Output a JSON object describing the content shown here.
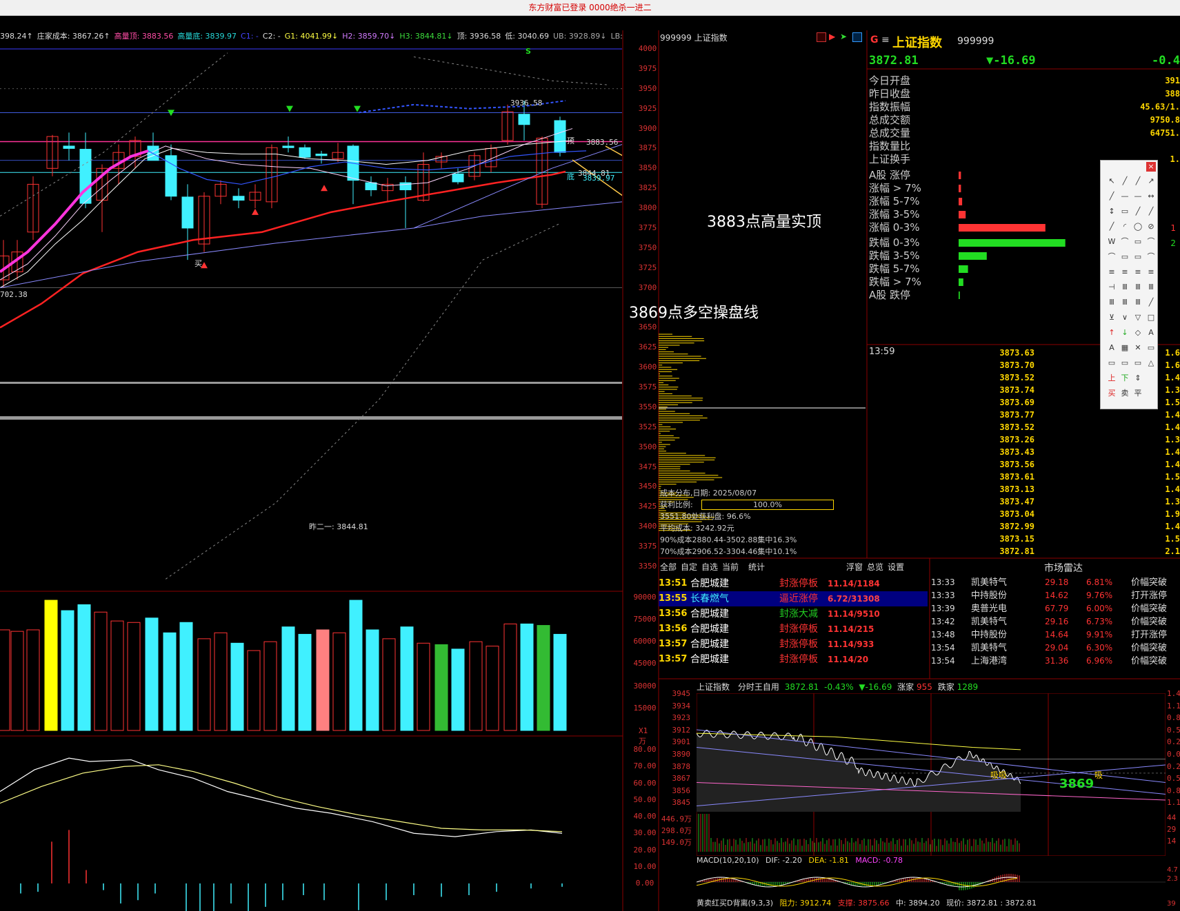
{
  "titlebar": {
    "text": "东方财富已登录  0000绝杀一进二"
  },
  "kline_info": [
    {
      "text": "398.24↑",
      "color": "#dddddd"
    },
    {
      "text": "庄家成本: 3867.26↑",
      "color": "#dddddd"
    },
    {
      "text": "高量顶: 3883.56",
      "color": "#ff4da6"
    },
    {
      "text": "高量底: 3839.97",
      "color": "#26d9d9"
    },
    {
      "text": "C1: -",
      "color": "#4444ff"
    },
    {
      "text": "C2: -",
      "color": "#dddddd"
    },
    {
      "text": "G1: 4041.99↓",
      "color": "#ffff44"
    },
    {
      "text": "H2: 3859.70↓",
      "color": "#d27bff"
    },
    {
      "text": "H3: 3844.81↓",
      "color": "#3cdc3c"
    },
    {
      "text": "顶: 3936.58",
      "color": "#dddddd"
    },
    {
      "text": "低: 3040.69",
      "color": "#dddddd"
    },
    {
      "text": "UB: 3928.89↓",
      "color": "#aaaaaa"
    },
    {
      "text": "LB: 3",
      "color": "#aaaaaa"
    }
  ],
  "price_axis": [
    "4000",
    "3975",
    "3950",
    "3925",
    "3900",
    "3875",
    "3850",
    "3825",
    "3800",
    "3775",
    "3750",
    "3725",
    "3700",
    "3650",
    "3625",
    "3600",
    "3575",
    "3550",
    "3525",
    "3500",
    "3475",
    "3450",
    "3425",
    "3400",
    "3375",
    "3350"
  ],
  "vol_axis": [
    "90000",
    "75000",
    "60000",
    "45000",
    "30000",
    "15000",
    "X1万"
  ],
  "ind_axis": [
    "80.00",
    "70.00",
    "60.00",
    "50.00",
    "40.00",
    "30.00",
    "20.00",
    "10.00",
    "0.00"
  ],
  "chart_labels": {
    "top_mark": "3936.58",
    "ding": "顶",
    "ding_val": "3883.56",
    "di": "底",
    "di_val": "3844.81",
    "di_val2": "3839.97",
    "left_low": "702.38",
    "buy": "买",
    "s_mark": "S",
    "yesterday": "昨二一: 3844.81"
  },
  "annotations": {
    "a1": "3883点高量实顶",
    "a2": "3869点多空操盘线"
  },
  "chip": {
    "header": "999999 上证指数",
    "date": "成本分布,日期: 2025/08/07",
    "profit_label": "获利比例:",
    "profit_pct": "100.0%",
    "l3": "3551.80处获利盘: 96.6%",
    "l4": "平均成本: 3242.92元",
    "l5": "90%成本2880.44-3502.88集中16.3%",
    "l6": "70%成本2906.52-3304.46集中10.1%"
  },
  "quote": {
    "g": "G",
    "menu": "≡",
    "name": "上证指数",
    "code": "999999",
    "price": "3872.81",
    "change": "▼-16.69",
    "pct": "-0.4",
    "rows": [
      {
        "label": "今日开盘",
        "value": "391"
      },
      {
        "label": "昨日收盘",
        "value": "388"
      },
      {
        "label": "指数振幅",
        "value": "45.63/1."
      },
      {
        "label": "总成交额",
        "value": "9750.8"
      },
      {
        "label": "总成交量",
        "value": "64751."
      },
      {
        "label": "指数量比",
        "value": ""
      },
      {
        "label": "上证换手",
        "value": "1."
      }
    ]
  },
  "dist": [
    {
      "label": "A股 涨停",
      "frac": 0.02,
      "color": "#ff3333",
      "value": ""
    },
    {
      "label": "涨幅 > 7%",
      "frac": 0.02,
      "color": "#ff3333",
      "value": ""
    },
    {
      "label": "涨幅 5-7%",
      "frac": 0.03,
      "color": "#ff3333",
      "value": ""
    },
    {
      "label": "涨幅 3-5%",
      "frac": 0.06,
      "color": "#ff3333",
      "value": ""
    },
    {
      "label": "涨幅 0-3%",
      "frac": 0.74,
      "color": "#ff3333",
      "value": "1"
    },
    {
      "label": "跌幅 0-3%",
      "frac": 0.91,
      "color": "#22dd22",
      "value": "2"
    },
    {
      "label": "跌幅 3-5%",
      "frac": 0.24,
      "color": "#22dd22",
      "value": ""
    },
    {
      "label": "跌幅 5-7%",
      "frac": 0.08,
      "color": "#22dd22",
      "value": ""
    },
    {
      "label": "跌幅 > 7%",
      "frac": 0.04,
      "color": "#22dd22",
      "value": ""
    },
    {
      "label": "A股 跌停",
      "frac": 0.01,
      "color": "#22dd22",
      "value": ""
    }
  ],
  "ticks": {
    "time": "13:59",
    "prices": [
      "3873.63",
      "3873.70",
      "3873.52",
      "3873.74",
      "3873.69",
      "3873.77",
      "3873.52",
      "3873.26",
      "3873.43",
      "3873.56",
      "3873.61",
      "3873.13",
      "3873.47",
      "3873.04",
      "3872.99",
      "3873.15",
      "3872.81"
    ],
    "vols": [
      "1.6",
      "1.6",
      "1.4",
      "1.3",
      "1.5",
      "1.4",
      "1.4",
      "1.3",
      "1.4",
      "1.4",
      "1.5",
      "1.4",
      "1.3",
      "1.9",
      "1.4",
      "1.5",
      "2.1"
    ]
  },
  "alerts_tabs": [
    "全部",
    "自定",
    "自选",
    "当前",
    "统计",
    "浮窗",
    "总览",
    "设置"
  ],
  "alerts": [
    {
      "time": "13:51",
      "name": "合肥城建",
      "type": "封涨停板",
      "val": "11.14/1184",
      "type_color": "#ff3333",
      "hl": false
    },
    {
      "time": "13:55",
      "name": "长春燃气",
      "type": "逼近涨停",
      "val": "6.72/31308",
      "type_color": "#ff3333",
      "hl": true
    },
    {
      "time": "13:56",
      "name": "合肥城建",
      "type": "封涨大减",
      "val": "11.14/9510",
      "type_color": "#22cc22",
      "hl": false
    },
    {
      "time": "13:56",
      "name": "合肥城建",
      "type": "封涨停板",
      "val": "11.14/215",
      "type_color": "#ff3333",
      "hl": false
    },
    {
      "time": "13:57",
      "name": "合肥城建",
      "type": "封涨停板",
      "val": "11.14/933",
      "type_color": "#ff3333",
      "hl": false
    },
    {
      "time": "13:57",
      "name": "合肥城建",
      "type": "封涨停板",
      "val": "11.14/20",
      "type_color": "#ff3333",
      "hl": false
    }
  ],
  "radar": {
    "title": "市场雷达",
    "rows": [
      {
        "time": "13:33",
        "name": "凯美特气",
        "price": "29.18",
        "pct": "6.81%",
        "ev": "价幅突破"
      },
      {
        "time": "13:33",
        "name": "中持股份",
        "price": "14.62",
        "pct": "9.76%",
        "ev": "打开涨停"
      },
      {
        "time": "13:39",
        "name": "奥普光电",
        "price": "67.79",
        "pct": "6.00%",
        "ev": "价幅突破"
      },
      {
        "time": "13:42",
        "name": "凯美特气",
        "price": "29.16",
        "pct": "6.73%",
        "ev": "价幅突破"
      },
      {
        "time": "13:48",
        "name": "中持股份",
        "price": "14.64",
        "pct": "9.91%",
        "ev": "打开涨停"
      },
      {
        "time": "13:54",
        "name": "凯美特气",
        "price": "29.04",
        "pct": "6.30%",
        "ev": "价幅突破"
      },
      {
        "time": "13:54",
        "name": "上海港湾",
        "price": "31.36",
        "pct": "6.96%",
        "ev": "价幅突破"
      }
    ]
  },
  "intraday": {
    "name": "上证指数",
    "mode": "分时王自用",
    "price": "3872.81",
    "pct": "-0.43%",
    "chg": "▼-16.69",
    "up_label": "涨家",
    "up": "955",
    "down_label": "跌家",
    "down": "1289",
    "axis": [
      "3945",
      "3934",
      "3923",
      "3912",
      "3901",
      "3890",
      "3878",
      "3867",
      "3856",
      "3845"
    ],
    "vaxis": [
      "446.9万",
      "298.0万",
      "149.0万"
    ],
    "raxis": [
      "1.4",
      "1.1",
      "0.8",
      "0.5",
      "0.2",
      "0.0",
      "0.2",
      "0.5",
      "0.8",
      "1.1"
    ],
    "rvaxis": [
      "44",
      "29",
      "14"
    ],
    "mark": "3869",
    "xi1": "吸吸",
    "xi2": "吸",
    "macd_label": "MACD(10,20,10)",
    "dif": "DIF: -2.20",
    "dea": "DEA: -1.81",
    "macd": "MACD: -0.78",
    "m_axis": [
      "4.7",
      "2.3"
    ],
    "bottom_label": "黄卖红买D背离(9,3,3)",
    "resist": "阻力: 3912.74",
    "support": "支撑: 3875.66",
    "mid": "中: 3894.20",
    "now": "现价: 3872.81 : 3872.81",
    "b_axis": "39"
  },
  "colors": {
    "up": "#ff3333",
    "down": "#22dd22",
    "axis": "#cc2222",
    "grid": "#8b0000",
    "cyan": "#40f0ff",
    "yellow": "#ffff00"
  }
}
